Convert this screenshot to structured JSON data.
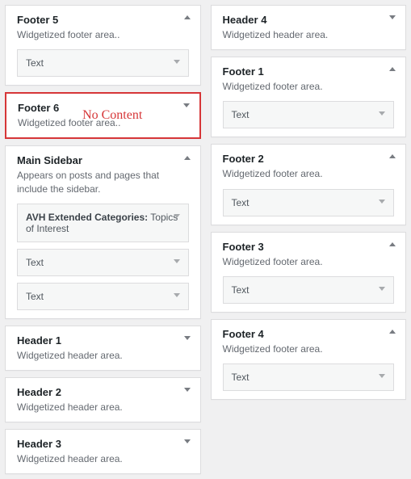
{
  "left": [
    {
      "title": "Footer 5",
      "desc": "Widgetized footer area..",
      "expanded": true,
      "highlight": false,
      "widgets": [
        {
          "label": "Text"
        }
      ]
    },
    {
      "title": "Footer 6",
      "desc": "Widgetized footer area..",
      "expanded": false,
      "highlight": true,
      "annotation": "No Content",
      "widgets": []
    },
    {
      "title": "Main Sidebar",
      "desc": "Appears on posts and pages that include the sidebar.",
      "expanded": true,
      "widgets": [
        {
          "label_strong": "AVH Extended Categories:",
          "label_rest": " Topics of Interest"
        },
        {
          "label": "Text"
        },
        {
          "label": "Text"
        }
      ]
    },
    {
      "title": "Header 1",
      "desc": "Widgetized header area.",
      "expanded": false,
      "widgets": []
    },
    {
      "title": "Header 2",
      "desc": "Widgetized header area.",
      "expanded": false,
      "widgets": []
    },
    {
      "title": "Header 3",
      "desc": "Widgetized header area.",
      "expanded": false,
      "widgets": []
    }
  ],
  "right": [
    {
      "title": "Header 4",
      "desc": "Widgetized header area.",
      "expanded": false,
      "widgets": []
    },
    {
      "title": "Footer 1",
      "desc": "Widgetized footer area.",
      "expanded": true,
      "widgets": [
        {
          "label": "Text"
        }
      ]
    },
    {
      "title": "Footer 2",
      "desc": "Widgetized footer area.",
      "expanded": true,
      "widgets": [
        {
          "label": "Text"
        }
      ]
    },
    {
      "title": "Footer 3",
      "desc": "Widgetized footer area.",
      "expanded": true,
      "widgets": [
        {
          "label": "Text"
        }
      ]
    },
    {
      "title": "Footer 4",
      "desc": "Widgetized footer area.",
      "expanded": true,
      "widgets": [
        {
          "label": "Text"
        }
      ]
    }
  ]
}
